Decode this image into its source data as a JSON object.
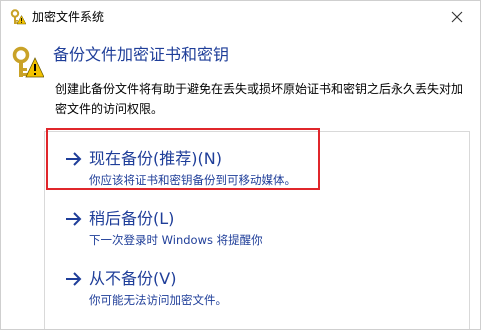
{
  "window": {
    "title": "加密文件系统"
  },
  "header": {
    "title": "备份文件加密证书和密钥",
    "description": "创建此备份文件将有助于避免在丢失或损坏原始证书和密钥之后永久丢失对加密文件的访问权限。"
  },
  "options": [
    {
      "title": "现在备份(推荐)(N)",
      "description": "你应该将证书和密钥备份到可移动媒体。"
    },
    {
      "title": "稍后备份(L)",
      "description": "下一次登录时 Windows 将提醒你"
    },
    {
      "title": "从不备份(V)",
      "description": "你可能无法访问加密文件。"
    }
  ],
  "colors": {
    "link_blue": "#1f3e99",
    "highlight_red": "#e0262b"
  },
  "icons": {
    "title": "key-warning-icon",
    "header": "key-warning-large-icon",
    "option_arrow": "arrow-right-icon",
    "close": "close-icon"
  }
}
